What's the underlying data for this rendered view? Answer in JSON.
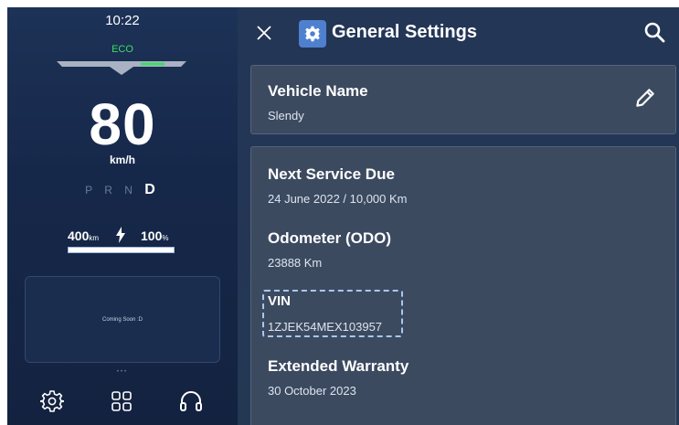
{
  "cluster": {
    "time": "10:22",
    "mode": "ECO",
    "speed": "80",
    "speed_unit": "km/h",
    "gears": {
      "inactive": "P R N",
      "active": "D"
    },
    "range_value": "400",
    "range_unit": "km",
    "battery_value": "100",
    "battery_unit": "%",
    "battery_level": 1.0,
    "media_card_text": "Coming Soon :D",
    "page_dots": "•••",
    "dock": [
      "gear-icon",
      "apps-grid-icon",
      "headset-icon"
    ]
  },
  "settings": {
    "title": "General Settings",
    "vehicle_name": {
      "label": "Vehicle Name",
      "value": "Slendy"
    },
    "items": [
      {
        "label": "Next Service Due",
        "value": "24 June 2022 / 10,000 Km"
      },
      {
        "label": "Odometer (ODO)",
        "value": "23888 Km"
      },
      {
        "label": "VIN",
        "value": "1ZJEK54MEX103957"
      },
      {
        "label": "Extended Warranty",
        "value": "30 October 2023"
      }
    ]
  },
  "colors": {
    "eco_green": "#3ddc68",
    "settings_badge": "#4f80cf",
    "card_bg": "#3c4a60"
  }
}
